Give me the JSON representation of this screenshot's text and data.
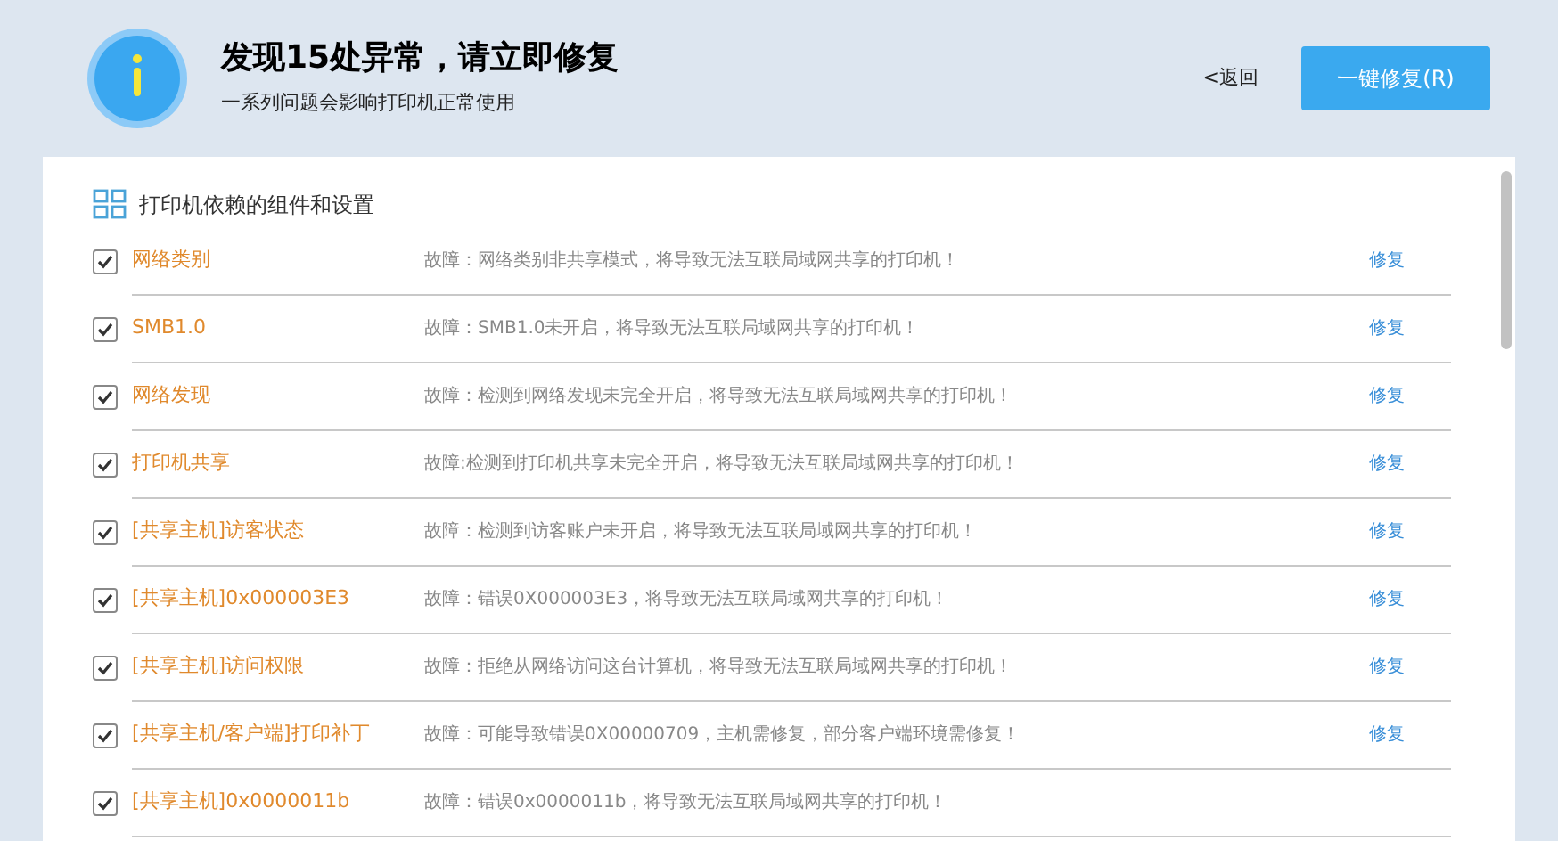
{
  "header": {
    "title": "发现15处异常，请立即修复",
    "subtitle": "一系列问题会影响打印机正常使用",
    "back": "<返回",
    "fix_all": "一键修复(R)"
  },
  "section": {
    "title": "打印机依赖的组件和设置"
  },
  "items": [
    {
      "name": "网络类别",
      "checked": true,
      "desc": "故障：网络类别非共享模式，将导致无法互联局域网共享的打印机！",
      "fix": "修复"
    },
    {
      "name": "SMB1.0",
      "checked": true,
      "desc": "故障：SMB1.0未开启，将导致无法互联局域网共享的打印机！",
      "fix": "修复"
    },
    {
      "name": "网络发现",
      "checked": true,
      "desc": "故障：检测到网络发现未完全开启，将导致无法互联局域网共享的打印机！",
      "fix": "修复"
    },
    {
      "name": "打印机共享",
      "checked": true,
      "desc": "故障:检测到打印机共享未完全开启，将导致无法互联局域网共享的打印机！",
      "fix": "修复"
    },
    {
      "name": "[共享主机]访客状态",
      "checked": true,
      "desc": "故障：检测到访客账户未开启，将导致无法互联局域网共享的打印机！",
      "fix": "修复"
    },
    {
      "name": "[共享主机]0x000003E3",
      "checked": true,
      "desc": "故障：错误0X000003E3，将导致无法互联局域网共享的打印机！",
      "fix": "修复"
    },
    {
      "name": "[共享主机]访问权限",
      "checked": true,
      "desc": "故障：拒绝从网络访问这台计算机，将导致无法互联局域网共享的打印机！",
      "fix": "修复"
    },
    {
      "name": "[共享主机/客户端]打印补丁",
      "checked": true,
      "desc": "故障：可能导致错误0X00000709，主机需修复，部分客户端环境需修复！",
      "fix": "修复"
    },
    {
      "name": "[共享主机]0x0000011b",
      "checked": true,
      "desc": "故障：错误0x0000011b，将导致无法互联局域网共享的打印机！"
    }
  ]
}
